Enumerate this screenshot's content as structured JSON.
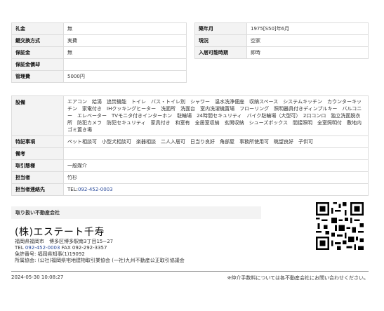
{
  "left_table": [
    {
      "label": "礼金",
      "value": "無"
    },
    {
      "label": "鍵交換方式",
      "value": "実費"
    },
    {
      "label": "保証金",
      "value": "無"
    },
    {
      "label": "保証金償却",
      "value": ""
    },
    {
      "label": "管理費",
      "value": "5000円"
    }
  ],
  "right_table": [
    {
      "label": "築年月",
      "value": "1975[S50]年6月"
    },
    {
      "label": "現況",
      "value": "空家"
    },
    {
      "label": "入居可能時期",
      "value": "即時"
    }
  ],
  "facilities": {
    "label": "設備",
    "value": "エアコン　給湯　追焚機能　トイレ　バス・トイレ別　シャワー　温水洗浄便座　収納スペース　システムキッチン　カウンターキッチン　家電付き　IHクッキングヒーター　洗面所　洗面台　室内洗濯機置場　フローリング　照明器具付きディンプルキー　バルコニー　エレベーター　TVモニタ付きインターホン　駐輪場　24時間セキュリティ　バイク駐輪場（大型可）　2口コンロ　独立洗面脱衣所　防犯カメラ　防犯セキュリティ　家具付き　和室有　全居室収納　玄関収納　シューズボックス　間接照明　全室照明付　敷地内ゴミ置き場"
  },
  "special_terms": {
    "label": "特記事項",
    "value": "ペット相談可　小型犬相談可　楽器相談　二人入居可　日当り良好　角部屋　事務所使用可　眺望良好　子供可"
  },
  "remarks": {
    "label": "備考",
    "value": ""
  },
  "transaction": {
    "label": "取引態様",
    "value": "一般媒介"
  },
  "staff": {
    "label": "担当者",
    "value": "竹杉"
  },
  "staff_contact": {
    "label": "担当者連絡先",
    "prefix": "TEL:",
    "tel": "092-452-0003"
  },
  "company": {
    "section_title": "取り扱い不動産会社",
    "name": "(株)エステート千寿",
    "address": "福岡県福岡市　博多区博多駅南3丁目15−27",
    "tel_label": "TEL",
    "tel": "092-452-0003",
    "fax": "FAX 092-292-3357",
    "license": "免許番号: 福岡県知事(1)19092",
    "association": "所属協会: (公社)福岡県宅地建物取引業協会 (一社)九州不動産公正取引協議会"
  },
  "footer": {
    "datetime": "2024-05-30 10:08:27",
    "note": "※仲介手数料については各不動産会社にお問い合わせください。"
  }
}
